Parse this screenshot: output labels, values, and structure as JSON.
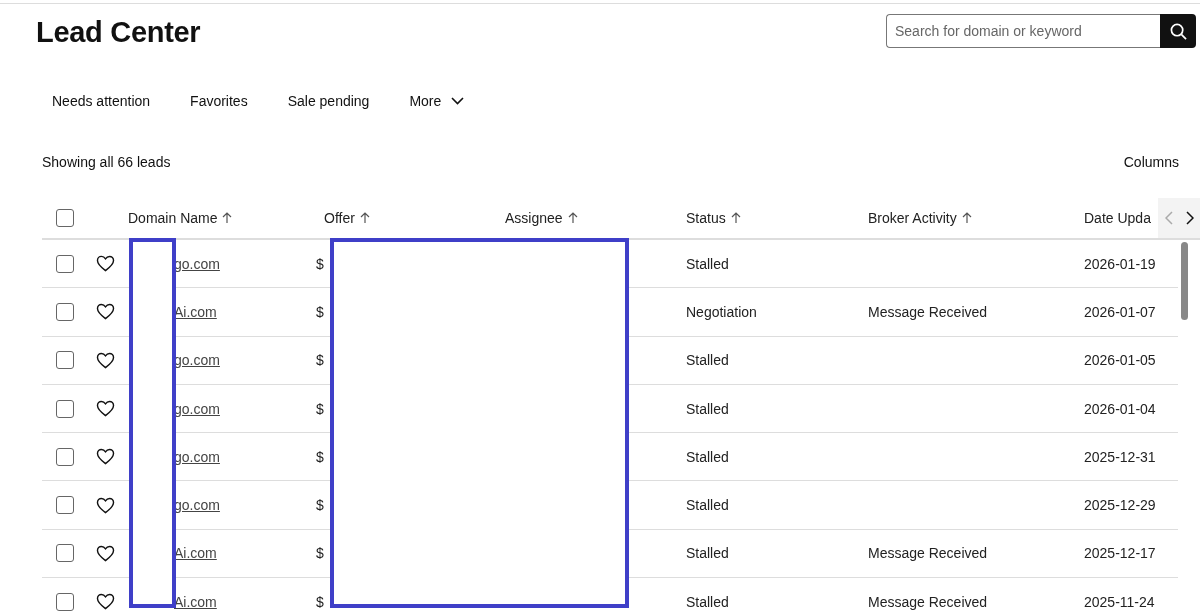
{
  "page": {
    "title": "Lead Center"
  },
  "search": {
    "placeholder": "Search for domain or keyword"
  },
  "tabs": [
    {
      "label": "Needs attention",
      "selected": false
    },
    {
      "label": "Favorites",
      "selected": false
    },
    {
      "label": "Sale pending",
      "selected": false
    },
    {
      "label": "More",
      "selected": false,
      "kind": "dropdown"
    }
  ],
  "summary": "Showing all 66 leads",
  "columns_button": "Columns",
  "table": {
    "select_all_checked": false,
    "columns": [
      {
        "label": "Domain Name",
        "sortable": true
      },
      {
        "label": "Offer",
        "sortable": true
      },
      {
        "label": "Assignee",
        "sortable": true
      },
      {
        "label": "Status",
        "sortable": true
      },
      {
        "label": "Broker Activity",
        "sortable": true
      },
      {
        "label": "Date Upda",
        "sortable": false
      }
    ],
    "rows": [
      {
        "checked": false,
        "favorite": false,
        "domain": "go.com",
        "offer": "$",
        "status": "Stalled",
        "broker_activity": "",
        "date": "2026-01-19"
      },
      {
        "checked": false,
        "favorite": false,
        "domain": "Ai.com",
        "offer": "$",
        "status": "Negotiation",
        "broker_activity": "Message Received",
        "date": "2026-01-07"
      },
      {
        "checked": false,
        "favorite": false,
        "domain": "go.com",
        "offer": "$",
        "status": "Stalled",
        "broker_activity": "",
        "date": "2026-01-05"
      },
      {
        "checked": false,
        "favorite": false,
        "domain": "go.com",
        "offer": "$",
        "status": "Stalled",
        "broker_activity": "",
        "date": "2026-01-04"
      },
      {
        "checked": false,
        "favorite": false,
        "domain": "go.com",
        "offer": "$",
        "status": "Stalled",
        "broker_activity": "",
        "date": "2025-12-31"
      },
      {
        "checked": false,
        "favorite": false,
        "domain": "go.com",
        "offer": "$",
        "status": "Stalled",
        "broker_activity": "",
        "date": "2025-12-29"
      },
      {
        "checked": false,
        "favorite": false,
        "domain": "Ai.com",
        "offer": "$",
        "status": "Stalled",
        "broker_activity": "Message Received",
        "date": "2025-12-17"
      },
      {
        "checked": false,
        "favorite": false,
        "domain": "Ai.com",
        "offer": "$",
        "status": "Stalled",
        "broker_activity": "Message Received",
        "date": "2025-11-24"
      }
    ]
  }
}
